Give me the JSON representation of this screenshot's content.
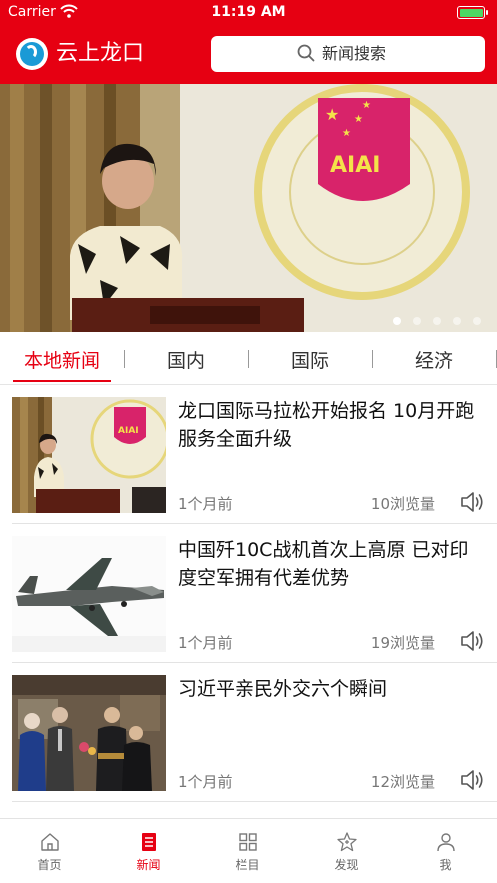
{
  "status_bar": {
    "carrier": "Carrier",
    "time": "11:19 AM"
  },
  "header": {
    "app_title": "云上龙口",
    "search_placeholder": "新闻搜索"
  },
  "banner": {
    "page_count": 5,
    "active_index": 0
  },
  "tabs": [
    {
      "label": "本地新闻",
      "active": true
    },
    {
      "label": "国内",
      "active": false
    },
    {
      "label": "国际",
      "active": false
    },
    {
      "label": "经济",
      "active": false
    }
  ],
  "news": [
    {
      "title": "龙口国际马拉松开始报名 10月开跑服务全面升级",
      "age": "1个月前",
      "views": "10浏览量"
    },
    {
      "title": "中国歼10C战机首次上高原 已对印度空军拥有代差优势",
      "age": "1个月前",
      "views": "19浏览量"
    },
    {
      "title": "习近平亲民外交六个瞬间",
      "age": "1个月前",
      "views": "12浏览量"
    }
  ],
  "bottom_nav": [
    {
      "label": "首页",
      "icon": "home-icon",
      "active": false
    },
    {
      "label": "新闻",
      "icon": "news-icon",
      "active": true
    },
    {
      "label": "栏目",
      "icon": "grid-icon",
      "active": false
    },
    {
      "label": "发现",
      "icon": "discover-icon",
      "active": false
    },
    {
      "label": "我",
      "icon": "user-icon",
      "active": false
    }
  ],
  "colors": {
    "brand_red": "#e60012",
    "logo_blue": "#1a9ad6",
    "battery_green": "#4cd964"
  }
}
